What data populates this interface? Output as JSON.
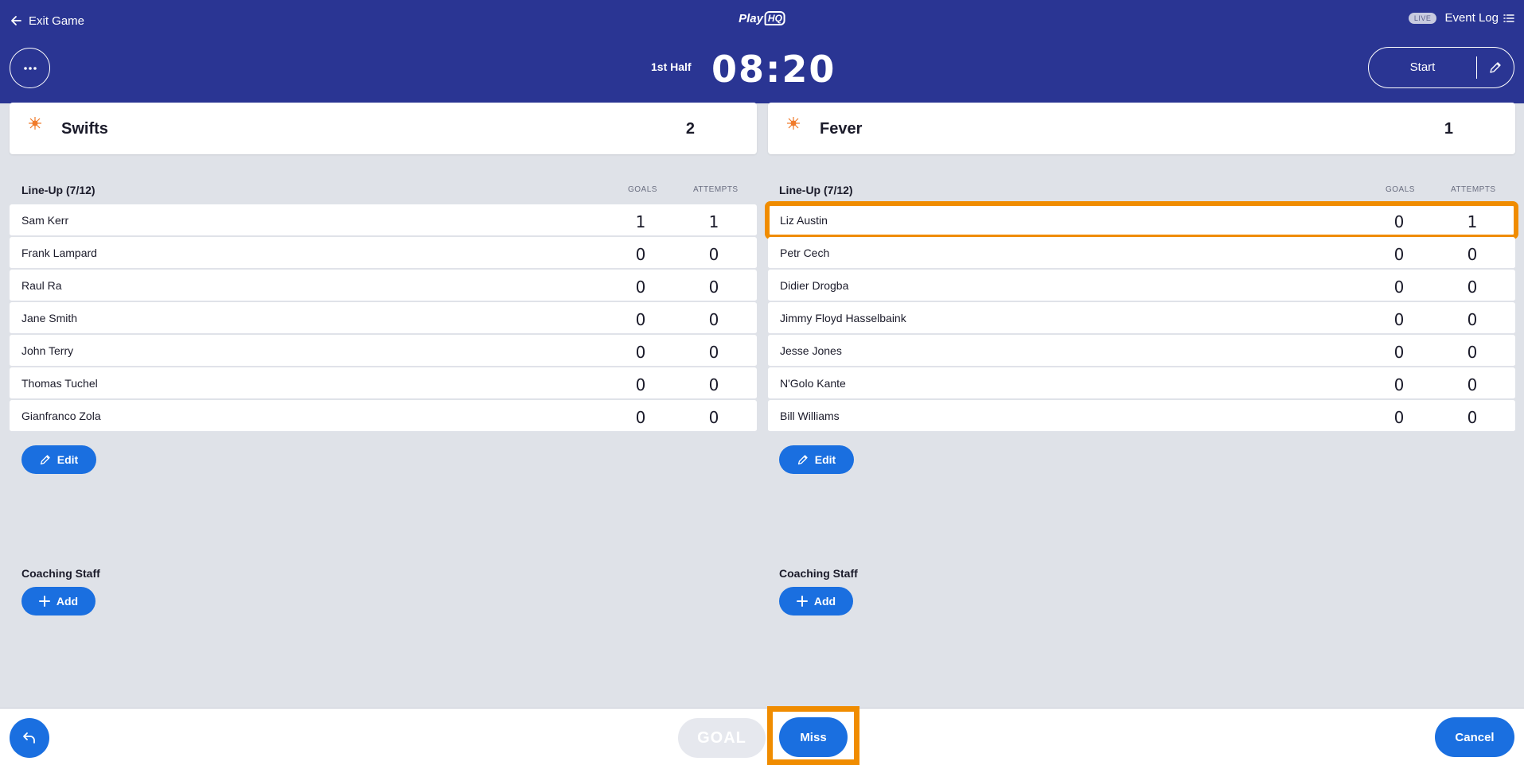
{
  "header": {
    "exit_label": "Exit Game",
    "logo_play": "Play",
    "logo_hq": "HQ",
    "live_badge": "LIVE",
    "event_log_label": "Event Log",
    "period": "1st Half",
    "clock": "08:20",
    "start_label": "Start"
  },
  "teams": [
    {
      "name": "Swifts",
      "score": "2",
      "lineup_label": "Line-Up (7/12)",
      "goals_header": "GOALS",
      "attempts_header": "ATTEMPTS",
      "players": [
        {
          "name": "Sam Kerr",
          "goals": "1",
          "attempts": "1"
        },
        {
          "name": "Frank Lampard",
          "goals": "0",
          "attempts": "0"
        },
        {
          "name": "Raul Ra",
          "goals": "0",
          "attempts": "0"
        },
        {
          "name": "Jane Smith",
          "goals": "0",
          "attempts": "0"
        },
        {
          "name": "John Terry",
          "goals": "0",
          "attempts": "0"
        },
        {
          "name": "Thomas Tuchel",
          "goals": "0",
          "attempts": "0"
        },
        {
          "name": "Gianfranco Zola",
          "goals": "0",
          "attempts": "0"
        }
      ],
      "edit_label": "Edit",
      "coaching_label": "Coaching Staff",
      "add_label": "Add"
    },
    {
      "name": "Fever",
      "score": "1",
      "lineup_label": "Line-Up (7/12)",
      "goals_header": "GOALS",
      "attempts_header": "ATTEMPTS",
      "players": [
        {
          "name": "Liz Austin",
          "goals": "0",
          "attempts": "1"
        },
        {
          "name": "Petr Cech",
          "goals": "0",
          "attempts": "0"
        },
        {
          "name": "Didier Drogba",
          "goals": "0",
          "attempts": "0"
        },
        {
          "name": "Jimmy Floyd Hasselbaink",
          "goals": "0",
          "attempts": "0"
        },
        {
          "name": "Jesse Jones",
          "goals": "0",
          "attempts": "0"
        },
        {
          "name": "N'Golo Kante",
          "goals": "0",
          "attempts": "0"
        },
        {
          "name": "Bill Williams",
          "goals": "0",
          "attempts": "0"
        }
      ],
      "edit_label": "Edit",
      "coaching_label": "Coaching Staff",
      "add_label": "Add"
    }
  ],
  "footer": {
    "goal_label": "GOAL",
    "miss_label": "Miss",
    "cancel_label": "Cancel"
  },
  "colors": {
    "header_bg": "#2a3593",
    "primary_button": "#1a6fe0",
    "highlight": "#f08c00",
    "page_bg": "#dfe2e8"
  }
}
